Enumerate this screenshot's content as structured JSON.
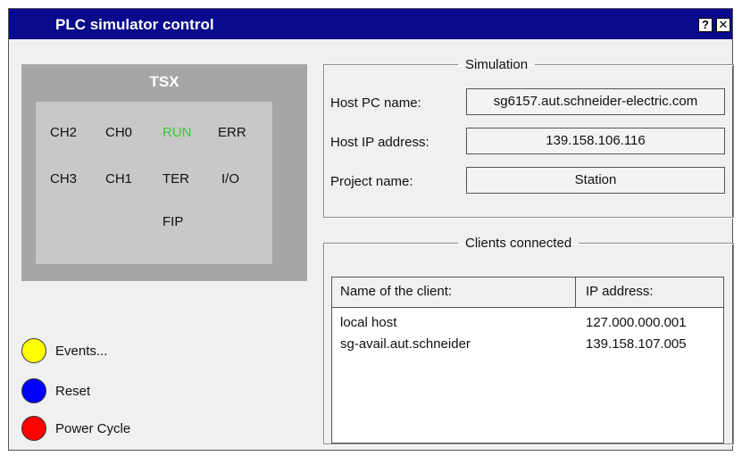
{
  "window": {
    "title": "PLC simulator control",
    "help_label": "?",
    "close_label": "✕"
  },
  "tsx": {
    "label": "TSX",
    "leds": [
      {
        "label": "CH2",
        "on": false
      },
      {
        "label": "CH0",
        "on": false
      },
      {
        "label": "RUN",
        "on": true
      },
      {
        "label": "ERR",
        "on": false
      },
      {
        "label": "CH3",
        "on": false
      },
      {
        "label": "CH1",
        "on": false
      },
      {
        "label": "TER",
        "on": false
      },
      {
        "label": "I/O",
        "on": false
      },
      {
        "label": "FIP",
        "on": false
      }
    ],
    "led_on_color": "#33cc33"
  },
  "simulation": {
    "legend": "Simulation",
    "host_pc_label": "Host PC name:",
    "host_pc_value": "sg6157.aut.schneider-electric.com",
    "host_ip_label": "Host IP address:",
    "host_ip_value": "139.158.106.116",
    "project_label": "Project name:",
    "project_value": "Station"
  },
  "clients": {
    "legend": "Clients connected",
    "columns": [
      "Name of the client:",
      "IP address:"
    ],
    "rows": [
      {
        "name": "local host",
        "ip": "127.000.000.001"
      },
      {
        "name": "sg-avail.aut.schneider",
        "ip": "139.158.107.005"
      }
    ]
  },
  "controls": [
    {
      "label": "Events...",
      "color": "#ffff00"
    },
    {
      "label": "Reset",
      "color": "#0000ff"
    },
    {
      "label": "Power Cycle",
      "color": "#ff0000"
    }
  ]
}
